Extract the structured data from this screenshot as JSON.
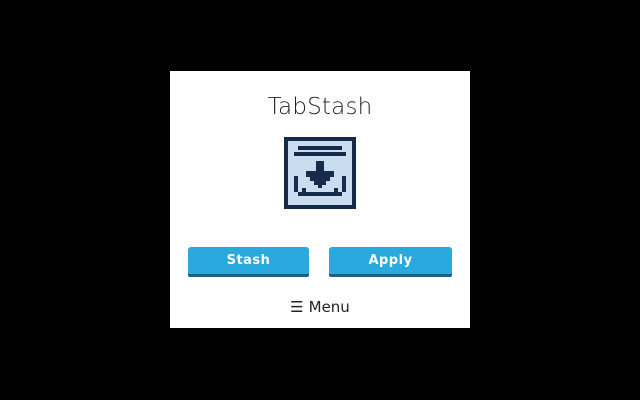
{
  "app": {
    "title": "TabStash"
  },
  "logo": {
    "icon": "inbox-download-icon",
    "colors": {
      "frame": "#142b4a",
      "fill": "#c9dcf0"
    }
  },
  "actions": {
    "stash_label": "Stash",
    "apply_label": "Apply"
  },
  "menu": {
    "icon": "☰",
    "label": "Menu"
  },
  "colors": {
    "backdrop": "#000000",
    "panel": "#ffffff",
    "button": "#29a9dd",
    "button_shadow": "#1b5f86"
  }
}
